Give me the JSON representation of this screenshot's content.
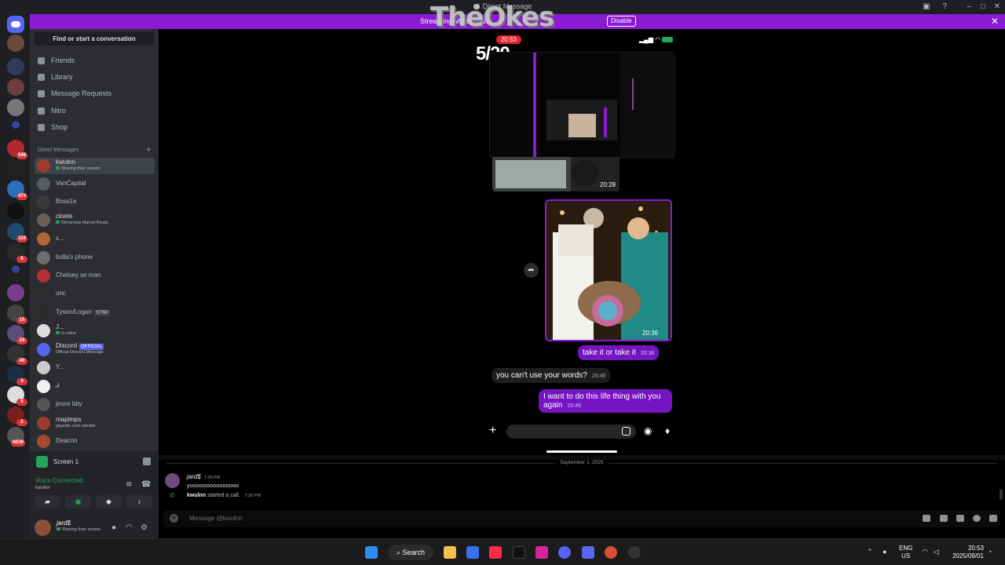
{
  "window": {
    "title": "Direct Message"
  },
  "banner": {
    "text": "Streaming Mode Use…",
    "disable_label": "Disable",
    "watermark": "TheOkes"
  },
  "rail": {
    "badges": [
      "548",
      "473",
      "119",
      "6",
      "15",
      "29",
      "40",
      "9",
      "5",
      "2",
      "NEW"
    ]
  },
  "sidebar": {
    "find_label": "Find or start a conversation",
    "nav": [
      {
        "label": "Friends",
        "icon": "friends-icon"
      },
      {
        "label": "Library",
        "icon": "library-icon"
      },
      {
        "label": "Message Requests",
        "icon": "mail-icon"
      },
      {
        "label": "Nitro",
        "icon": "nitro-icon"
      },
      {
        "label": "Shop",
        "icon": "shop-icon"
      }
    ],
    "dm_header": "Direct Messages",
    "dms": [
      {
        "name": "kwulnn",
        "sub": "Sharing their screen"
      },
      {
        "name": "VanCapital"
      },
      {
        "name": "Boss1e"
      },
      {
        "name": "cloete",
        "sub": "Streaming Marvel Rivals"
      },
      {
        "name": "s..."
      },
      {
        "name": "bolla's phone"
      },
      {
        "name": "Chelsey se man"
      },
      {
        "name": "unc"
      },
      {
        "name": "Tyson/Logan",
        "tag": "STRP"
      },
      {
        "name": "J...",
        "sub": "In voice"
      },
      {
        "name": "Discord",
        "tag": "OFFICIAL",
        "sub": "Official Discord Message"
      },
      {
        "name": "Y..."
      },
      {
        "name": "Ꮧ"
      },
      {
        "name": "jesse bby"
      },
      {
        "name": "mapimps",
        "sub": "gigantic cock wielder"
      },
      {
        "name": "Deacon"
      }
    ],
    "screen_label": "Screen 1",
    "voice": {
      "status": "Voice Connected",
      "channel": "kwulnn"
    },
    "user": {
      "name": "jard$",
      "status": "Sharing their screen"
    }
  },
  "phone": {
    "time": "20:53",
    "counter": "5/20",
    "img2_time": "20:28",
    "photo_time": "20:36",
    "messages": [
      {
        "from": "me",
        "text": "take it or take it",
        "time": "20:36"
      },
      {
        "from": "them",
        "text": "you can't use your words?",
        "time": "20:45"
      },
      {
        "from": "me",
        "text": "I want to do this life thing with you again",
        "time": "20:49"
      }
    ]
  },
  "chat": {
    "date": "September 1, 2025",
    "author": "jard$",
    "author_time": "7:39 PM",
    "text": "yooooooooooooooo",
    "call_user": "kwulnn",
    "call_text": "started a call.",
    "call_time": "7:39 PM",
    "placeholder": "Message @kwulnn"
  },
  "taskbar": {
    "search_label": "Search",
    "lang1": "ENG",
    "lang2": "US",
    "time": "20:53",
    "date": "2025/09/01"
  },
  "colors": {
    "accent": "#8a1bd2",
    "bubble_me": "#7514c1",
    "online": "#23a55a",
    "badge": "#da373c"
  }
}
